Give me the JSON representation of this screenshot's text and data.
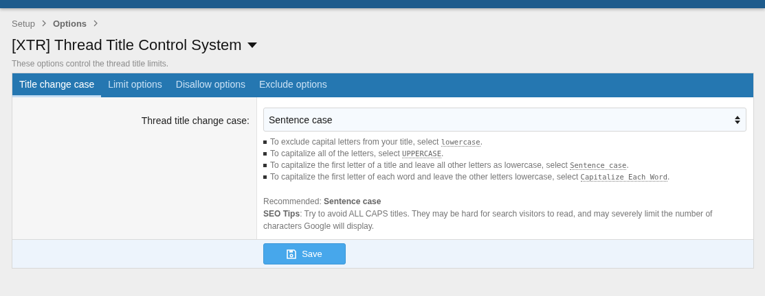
{
  "breadcrumb": [
    {
      "label": "Setup",
      "current": false
    },
    {
      "label": "Options",
      "current": true
    }
  ],
  "title": "[XTR] Thread Title Control System",
  "description": "These options control the thread title limits.",
  "tabs": [
    {
      "label": "Title change case",
      "selected": true
    },
    {
      "label": "Limit options",
      "selected": false
    },
    {
      "label": "Disallow options",
      "selected": false
    },
    {
      "label": "Exclude options",
      "selected": false
    }
  ],
  "field": {
    "label": "Thread title change case:",
    "value": "Sentence case"
  },
  "hints": [
    {
      "text": "To exclude capital letters from your title, select ",
      "code": "lowercase",
      "end": "."
    },
    {
      "text": "To capitalize all of the letters, select ",
      "code": "UPPERCASE",
      "end": "."
    },
    {
      "text": "To capitalize the first letter of a title and leave all other letters as lowercase, select ",
      "code": "Sentence case",
      "end": "."
    },
    {
      "text": "To capitalize the first letter of each word and leave the other letters lowercase, select ",
      "code": "Capitalize Each Word",
      "end": "."
    }
  ],
  "notes": [
    "Recommended: **Sentence case**",
    "**SEO Tips**: Try to avoid ALL CAPS titles. They may be hard for search visitors to read, and may severely limit the number of characters Google will display."
  ],
  "save_button": "Save"
}
